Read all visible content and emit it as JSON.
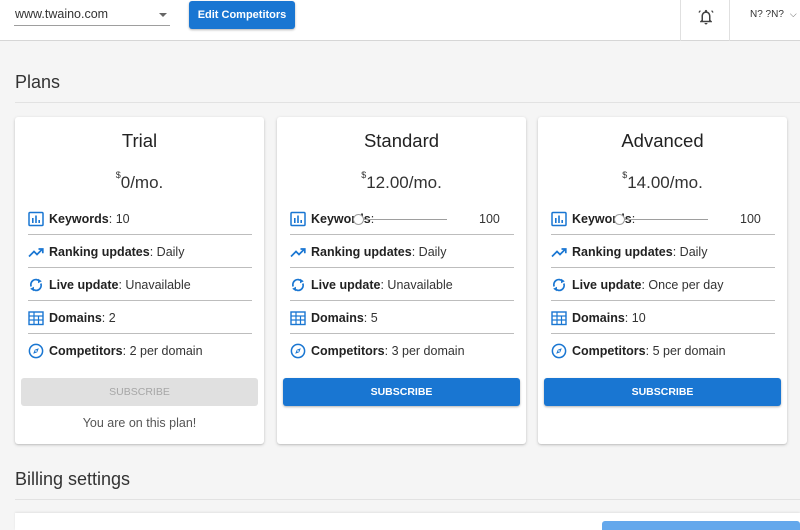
{
  "header": {
    "site_select_value": "www.twaino.com",
    "edit_button_label": "Edit Competitors",
    "user_menu_label": "N? ?N?"
  },
  "sections": {
    "plans_title": "Plans",
    "billing_title": "Billing settings"
  },
  "plans": [
    {
      "name": "Trial",
      "price_currency": "$",
      "price_amount": "0/mo.",
      "features": {
        "keywords_label": "Keywords",
        "keywords_value": ": 10",
        "ranking_label": "Ranking updates",
        "ranking_value": ": Daily",
        "live_label": "Live update",
        "live_value": ": Unavailable",
        "domains_label": "Domains",
        "domains_value": ": 2",
        "competitors_label": "Competitors",
        "competitors_value": ": 2 per domain"
      },
      "subscribe_label": "SUBSCRIBE",
      "subscribe_enabled": false,
      "current_note": "You are on this plan!"
    },
    {
      "name": "Standard",
      "price_currency": "$",
      "price_amount": "12.00/mo.",
      "features": {
        "keywords_label": "Keywords",
        "keywords_sep": ":",
        "keywords_slider_value": "100",
        "ranking_label": "Ranking updates",
        "ranking_value": ": Daily",
        "live_label": "Live update",
        "live_value": ": Unavailable",
        "domains_label": "Domains",
        "domains_value": ": 5",
        "competitors_label": "Competitors",
        "competitors_value": ": 3 per domain"
      },
      "subscribe_label": "SUBSCRIBE",
      "subscribe_enabled": true
    },
    {
      "name": "Advanced",
      "price_currency": "$",
      "price_amount": "14.00/mo.",
      "features": {
        "keywords_label": "Keywords",
        "keywords_sep": ":",
        "keywords_slider_value": "100",
        "ranking_label": "Ranking updates",
        "ranking_value": ": Daily",
        "live_label": "Live update",
        "live_value": ": Once per day",
        "domains_label": "Domains",
        "domains_value": ": 10",
        "competitors_label": "Competitors",
        "competitors_value": ": 5 per domain"
      },
      "subscribe_label": "SUBSCRIBE",
      "subscribe_enabled": true
    }
  ],
  "colors": {
    "accent": "#1976d2",
    "background": "#f5f5f5",
    "card": "#ffffff",
    "disabled_button": "#e0e0e0"
  },
  "icons": {
    "notifications": "bell-icon",
    "keywords": "bar-chart-icon",
    "ranking_updates": "trending-up-icon",
    "live_update": "sync-icon",
    "domains": "domain-icon",
    "competitors": "compass-icon"
  }
}
